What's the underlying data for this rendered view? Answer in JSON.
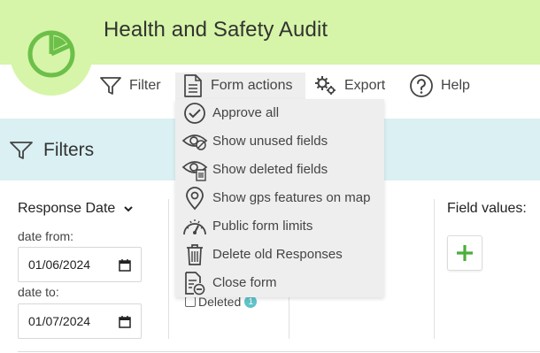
{
  "app": {
    "title": "Health and Safety Audit"
  },
  "toolbar": {
    "filter_label": "Filter",
    "form_actions_label": "Form actions",
    "export_label": "Export",
    "help_label": "Help"
  },
  "form_actions_menu": {
    "items": [
      {
        "label": "Approve all",
        "icon": "check-circle-icon"
      },
      {
        "label": "Show unused fields",
        "icon": "eye-slash-icon"
      },
      {
        "label": "Show deleted fields",
        "icon": "eye-trash-icon"
      },
      {
        "label": "Show gps features on map",
        "icon": "map-pin-icon"
      },
      {
        "label": "Public form limits",
        "icon": "gauge-icon"
      },
      {
        "label": "Delete old Responses",
        "icon": "trash-icon"
      },
      {
        "label": "Close form",
        "icon": "document-minus-icon"
      }
    ]
  },
  "filters": {
    "title": "Filters",
    "date_field_select": "Response Date",
    "date_from_label": "date from:",
    "date_from_value": "01/06/2024",
    "date_to_label": "date to:",
    "date_to_value": "01/07/2024",
    "deleted_label": "Deleted",
    "deleted_count": "1",
    "field_values_label": "Field values:"
  },
  "colors": {
    "header_bg": "#d6f5a8",
    "brand_green": "#6cc04a",
    "filters_bg": "#daf0f3",
    "menu_bg": "#eeeeee",
    "badge": "#5fc4c9"
  }
}
